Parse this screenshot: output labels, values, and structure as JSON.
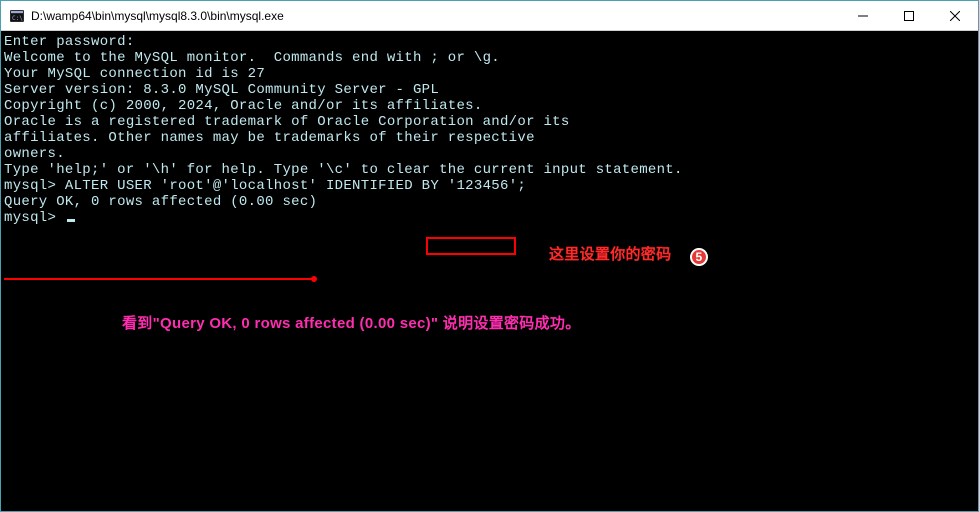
{
  "window": {
    "title": "D:\\wamp64\\bin\\mysql\\mysql8.3.0\\bin\\mysql.exe"
  },
  "terminal": {
    "l01": "Enter password:",
    "l02": "Welcome to the MySQL monitor.  Commands end with ; or \\g.",
    "l03": "Your MySQL connection id is 27",
    "l04": "Server version: 8.3.0 MySQL Community Server - GPL",
    "l05": "",
    "l06": "Copyright (c) 2000, 2024, Oracle and/or its affiliates.",
    "l07": "",
    "l08": "Oracle is a registered trademark of Oracle Corporation and/or its",
    "l09": "affiliates. Other names may be trademarks of their respective",
    "l10": "owners.",
    "l11": "",
    "l12": "Type 'help;' or '\\h' for help. Type '\\c' to clear the current input statement.",
    "l13": "",
    "prompt1_pre": "mysql> ALTER USER 'root'@'localhost' IDENTIFIED BY ",
    "prompt1_hl": "'123456';",
    "l15": "Query OK, 0 rows affected (0.00 sec)",
    "l16": "",
    "prompt2": "mysql> "
  },
  "annotations": {
    "red_note": "这里设置你的密码",
    "step_num": "5",
    "pink_note": "看到\"Query OK, 0 rows affected (0.00 sec)\" 说明设置密码成功。"
  }
}
